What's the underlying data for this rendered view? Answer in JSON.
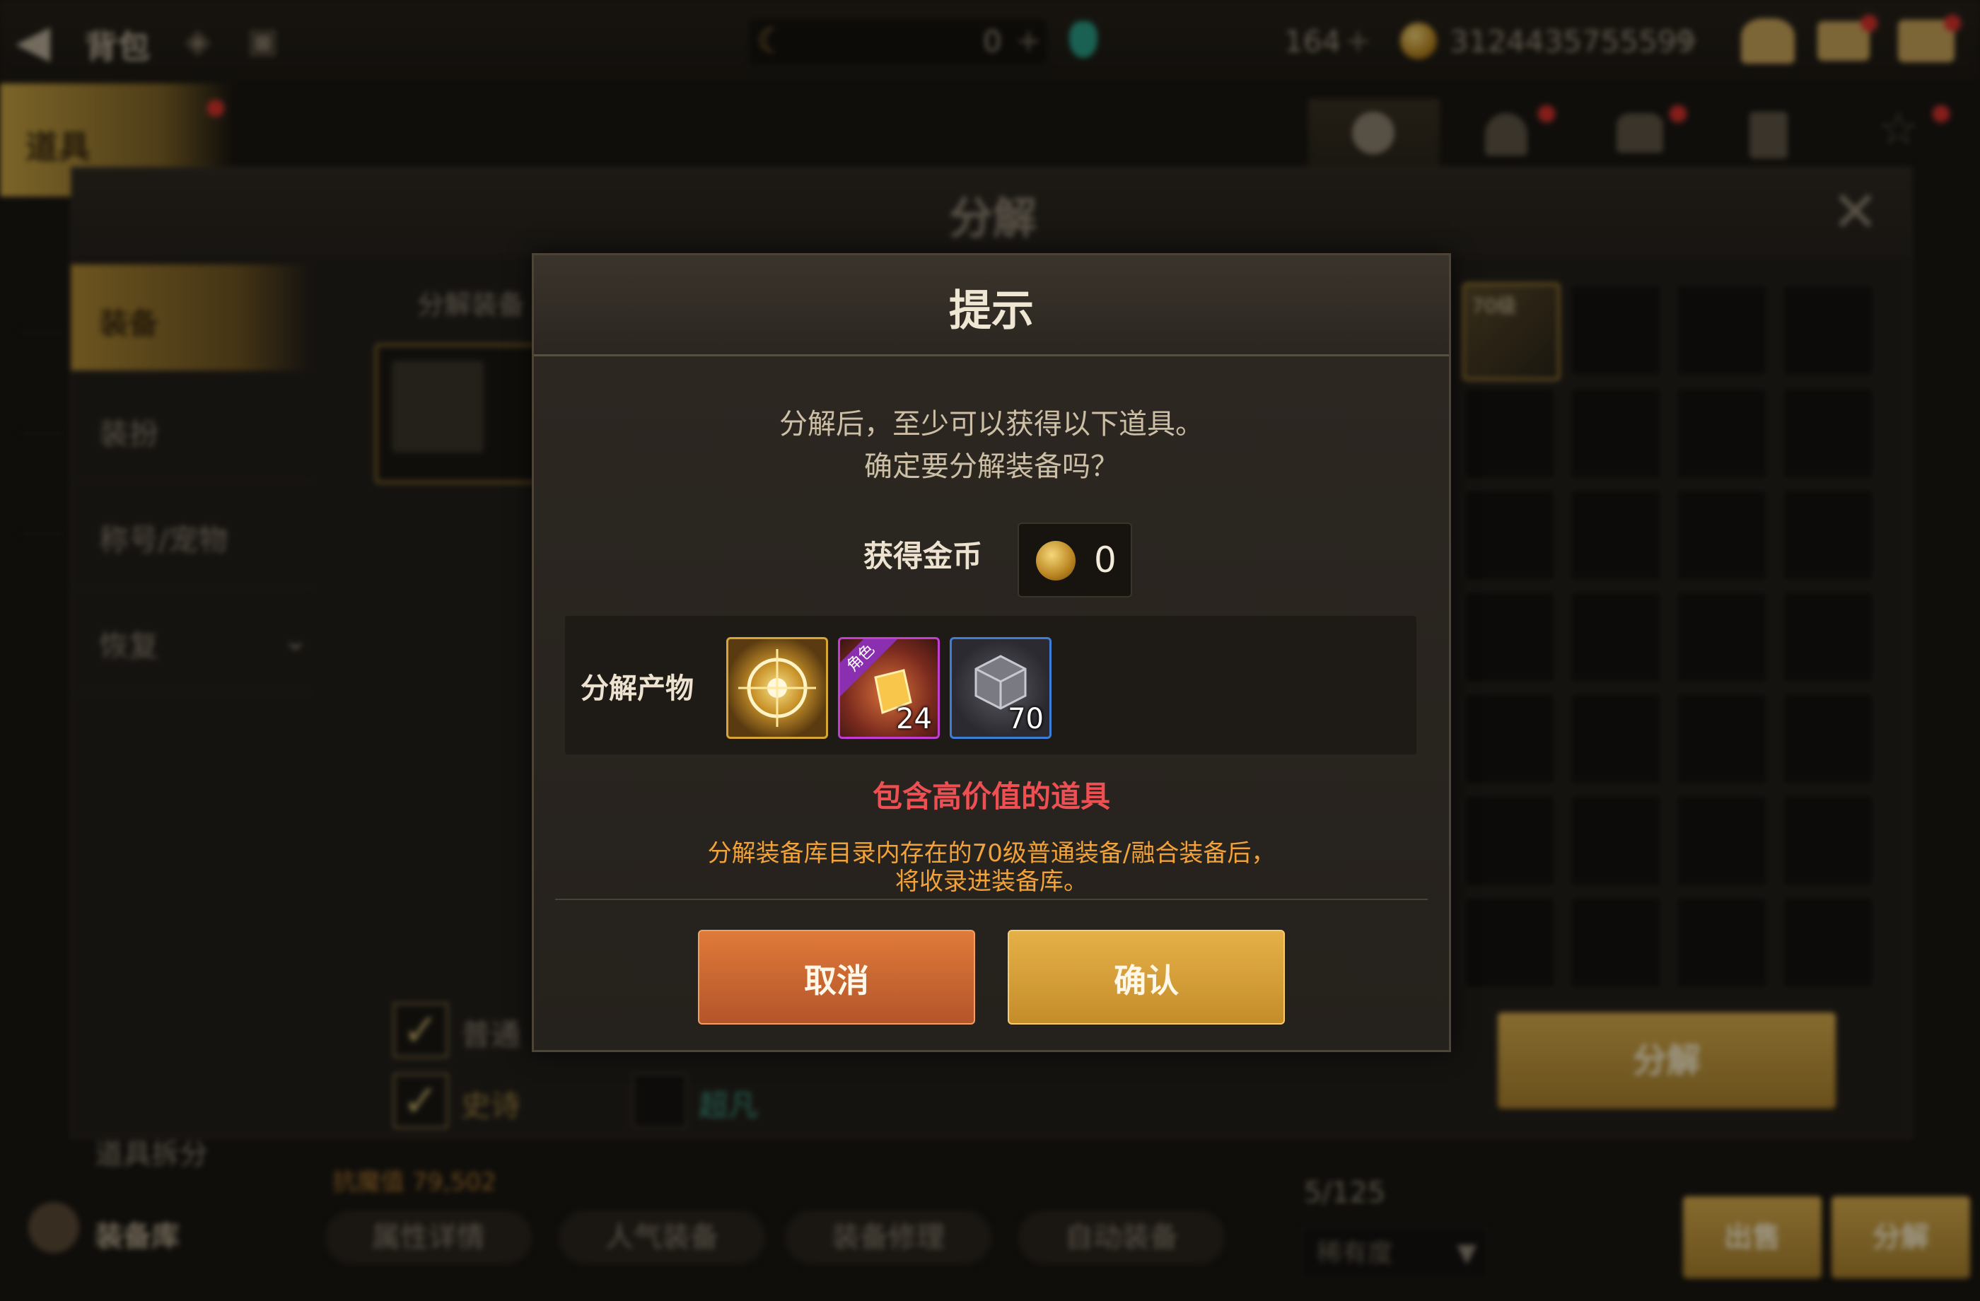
{
  "background": {
    "header": {
      "title": "背包",
      "resource_1": "0",
      "resource_2": "164",
      "gold": "3124435755599"
    },
    "left_tabs": [
      "道具"
    ],
    "panel_title": "分解",
    "panel_subtitle": "分解装备",
    "sidebar_items": [
      "装备",
      "装扮",
      "称号/宠物",
      "恢复"
    ],
    "filters": [
      "普通",
      "史诗",
      "超凡"
    ],
    "slot_label": "70级",
    "decompose_button": "分解",
    "bottom_buttons": [
      "属性详情",
      "人气装备",
      "装备修理",
      "自动装备"
    ],
    "left_bottom": [
      "道具拆分",
      "装备库"
    ],
    "capacity": "5/125",
    "sort_label": "稀有度",
    "sell_button": "出售",
    "split_button": "分解",
    "stat_line": "抗魔值 79,502"
  },
  "dialog": {
    "title": "提示",
    "message_line1": "分解后，至少可以获得以下道具。",
    "message_line2": "确定要分解装备吗？",
    "gold_label": "获得金币",
    "gold_value": "0",
    "products_label": "分解产物",
    "products": [
      {
        "name": "golden-orb-item",
        "count": "",
        "frame_color": "#d7a534"
      },
      {
        "name": "role-crystal-item",
        "count": "24",
        "frame_color": "#c13fd0",
        "tag": "角色"
      },
      {
        "name": "grey-cube-item",
        "count": "70",
        "frame_color": "#3d7fd6"
      }
    ],
    "warning_high_value": "包含高价值的道具",
    "warning_line1": "分解装备库目录内存在的70级普通装备/融合装备后，",
    "warning_line2": "将收录进装备库。",
    "cancel_label": "取消",
    "confirm_label": "确认"
  },
  "colors": {
    "warning_red": "#ee4f52",
    "warning_orange": "#f2a23a",
    "cancel": "#d06a34",
    "confirm": "#d9a13c"
  }
}
